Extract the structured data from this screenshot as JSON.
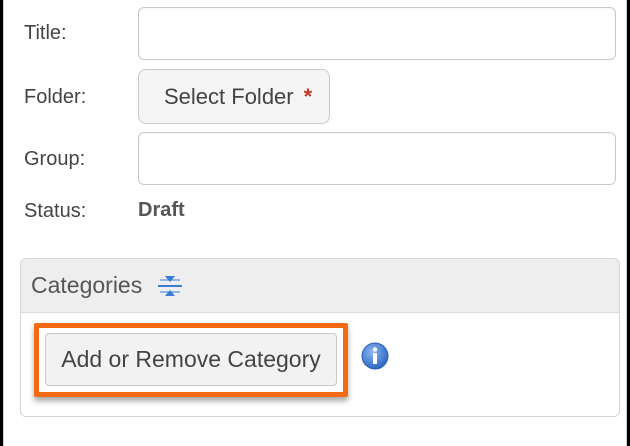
{
  "form": {
    "title_label": "Title:",
    "title_value": "",
    "folder_label": "Folder:",
    "folder_button_label": "Select Folder",
    "required_marker": "*",
    "group_label": "Group:",
    "group_value": "",
    "status_label": "Status:",
    "status_value": "Draft"
  },
  "categories": {
    "title": "Categories",
    "collapse_icon": "collapse-expand-icon",
    "add_remove_button_label": "Add or Remove Category",
    "info_icon": "info-icon"
  },
  "colors": {
    "highlight_border": "#f26a12",
    "required_star": "#c0392b",
    "info_blue": "#3a7bd5"
  }
}
